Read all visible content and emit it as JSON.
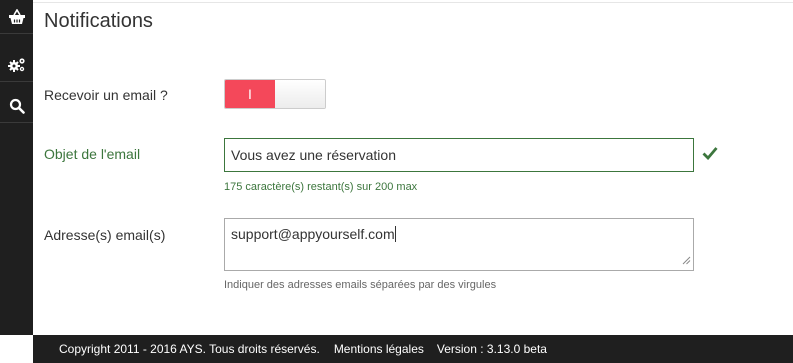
{
  "sidebar": {
    "items": [
      {
        "icon": "basket-icon"
      },
      {
        "icon": "gears-icon"
      },
      {
        "icon": "search-icon"
      }
    ]
  },
  "section": {
    "title": "Notifications"
  },
  "form": {
    "receive_email": {
      "label": "Recevoir un email ?",
      "toggle_on_text": "I",
      "state": "on"
    },
    "subject": {
      "label": "Objet de l'email",
      "value": "Vous avez une réservation",
      "help": "175 caractère(s) restant(s) sur 200 max",
      "valid": true
    },
    "addresses": {
      "label": "Adresse(s) email(s)",
      "value": "support@appyourself.com",
      "help": "Indiquer des adresses emails séparées par des virgules"
    }
  },
  "footer": {
    "copyright": "Copyright 2011 - 2016 AYS. Tous droits réservés.",
    "legal_link": "Mentions légales",
    "version": "Version : 3.13.0 beta"
  },
  "colors": {
    "sidebar_bg": "#1f1f1f",
    "toggle_on": "#f4485a",
    "success": "#3c763d"
  }
}
